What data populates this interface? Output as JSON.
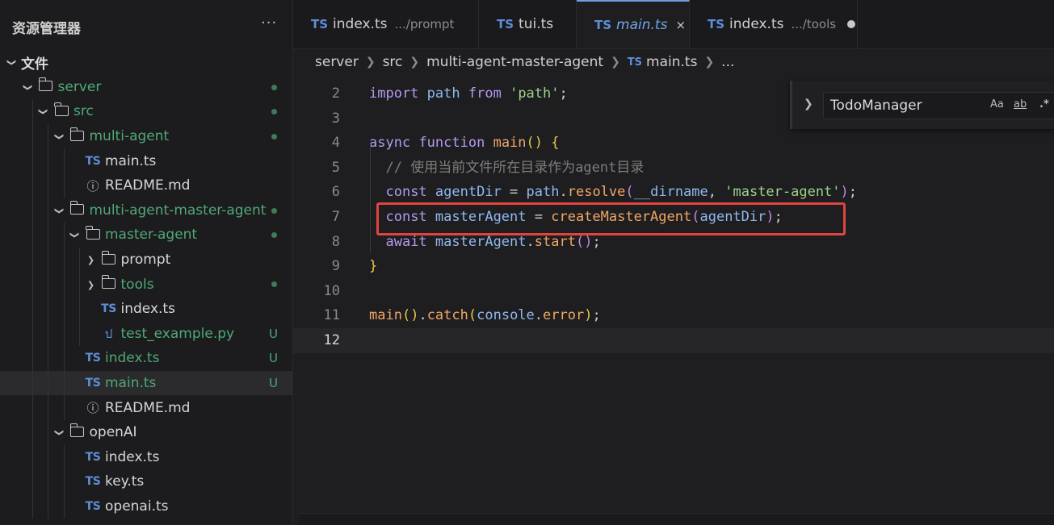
{
  "sidebar": {
    "title": "资源管理器",
    "more": "···",
    "tree": [
      {
        "label": "文件",
        "depth": 0,
        "type": "section",
        "expanded": true
      },
      {
        "label": "server",
        "depth": 1,
        "type": "folder",
        "expanded": true,
        "green": true,
        "dot": true
      },
      {
        "label": "src",
        "depth": 2,
        "type": "folder",
        "expanded": true,
        "green": true,
        "dot": true
      },
      {
        "label": "multi-agent",
        "depth": 3,
        "type": "folder",
        "expanded": true,
        "green": true,
        "dot": true
      },
      {
        "label": "main.ts",
        "depth": 4,
        "type": "ts"
      },
      {
        "label": "README.md",
        "depth": 4,
        "type": "info"
      },
      {
        "label": "multi-agent-master-agent",
        "depth": 3,
        "type": "folder",
        "expanded": true,
        "green": true,
        "dot": true
      },
      {
        "label": "master-agent",
        "depth": 4,
        "type": "folder",
        "expanded": true,
        "green": true,
        "dot": true
      },
      {
        "label": "prompt",
        "depth": 5,
        "type": "folder",
        "expanded": false
      },
      {
        "label": "tools",
        "depth": 5,
        "type": "folder",
        "expanded": false,
        "green": true,
        "dot": true
      },
      {
        "label": "index.ts",
        "depth": 5,
        "type": "ts"
      },
      {
        "label": "test_example.py",
        "depth": 5,
        "type": "py",
        "green": true,
        "badge": "U"
      },
      {
        "label": "index.ts",
        "depth": 4,
        "type": "ts",
        "green": true,
        "badge": "U"
      },
      {
        "label": "main.ts",
        "depth": 4,
        "type": "ts",
        "green": true,
        "badge": "U",
        "selected": true
      },
      {
        "label": "README.md",
        "depth": 4,
        "type": "info"
      },
      {
        "label": "openAI",
        "depth": 3,
        "type": "folder",
        "expanded": true
      },
      {
        "label": "index.ts",
        "depth": 4,
        "type": "ts"
      },
      {
        "label": "key.ts",
        "depth": 4,
        "type": "ts"
      },
      {
        "label": "openai.ts",
        "depth": 4,
        "type": "ts"
      }
    ]
  },
  "tabs": [
    {
      "icon": "TS",
      "name": "index.ts",
      "desc": ".../prompt"
    },
    {
      "icon": "TS",
      "name": "tui.ts"
    },
    {
      "icon": "TS",
      "name": "main.ts",
      "active": true,
      "close": "×"
    },
    {
      "icon": "TS",
      "name": "index.ts",
      "desc": ".../tools",
      "modified": true
    }
  ],
  "breadcrumb": {
    "parts": [
      "server",
      "src",
      "multi-agent-master-agent"
    ],
    "file_icon": "TS",
    "file": "main.ts",
    "ellipsis": "..."
  },
  "find_widget": {
    "value": "TodoManager",
    "opt_case": "Aa",
    "opt_word": "ab",
    "opt_regex": ".*"
  },
  "editor": {
    "current_line": 12,
    "lines": [
      {
        "n": "2",
        "tokens": [
          [
            "kw",
            "import"
          ],
          [
            "plain",
            " "
          ],
          [
            "var",
            "path"
          ],
          [
            "plain",
            " "
          ],
          [
            "kw",
            "from"
          ],
          [
            "plain",
            " "
          ],
          [
            "str",
            "'path'"
          ],
          [
            "plain",
            ";"
          ]
        ]
      },
      {
        "n": "3",
        "tokens": []
      },
      {
        "n": "4",
        "tokens": [
          [
            "kw",
            "async"
          ],
          [
            "plain",
            " "
          ],
          [
            "kw",
            "function"
          ],
          [
            "plain",
            " "
          ],
          [
            "fn",
            "main"
          ],
          [
            "br",
            "()"
          ],
          [
            "plain",
            " "
          ],
          [
            "br",
            "{"
          ]
        ]
      },
      {
        "n": "5",
        "tokens": [
          [
            "plain",
            "  "
          ],
          [
            "cmt",
            "// 使用当前文件所在目录作为agent目录"
          ]
        ]
      },
      {
        "n": "6",
        "tokens": [
          [
            "plain",
            "  "
          ],
          [
            "kw",
            "const"
          ],
          [
            "plain",
            " "
          ],
          [
            "var",
            "agentDir"
          ],
          [
            "plain",
            " = "
          ],
          [
            "var",
            "path"
          ],
          [
            "plain",
            "."
          ],
          [
            "fn",
            "resolve"
          ],
          [
            "brp",
            "("
          ],
          [
            "var",
            "__dirname"
          ],
          [
            "plain",
            ", "
          ],
          [
            "str",
            "'master-agent'"
          ],
          [
            "brp",
            ")"
          ],
          [
            "plain",
            ";"
          ]
        ]
      },
      {
        "n": "7",
        "tokens": [
          [
            "plain",
            "  "
          ],
          [
            "kw",
            "const"
          ],
          [
            "plain",
            " "
          ],
          [
            "var",
            "masterAgent"
          ],
          [
            "plain",
            " = "
          ],
          [
            "fn",
            "createMasterAgent"
          ],
          [
            "brp",
            "("
          ],
          [
            "var",
            "agentDir"
          ],
          [
            "brp",
            ")"
          ],
          [
            "plain",
            ";"
          ]
        ]
      },
      {
        "n": "8",
        "tokens": [
          [
            "plain",
            "  "
          ],
          [
            "kw",
            "await"
          ],
          [
            "plain",
            " "
          ],
          [
            "var",
            "masterAgent"
          ],
          [
            "plain",
            "."
          ],
          [
            "fn",
            "start"
          ],
          [
            "brp",
            "()"
          ],
          [
            "plain",
            ";"
          ]
        ]
      },
      {
        "n": "9",
        "tokens": [
          [
            "br",
            "}"
          ]
        ]
      },
      {
        "n": "10",
        "tokens": []
      },
      {
        "n": "11",
        "tokens": [
          [
            "fn",
            "main"
          ],
          [
            "br",
            "()"
          ],
          [
            "plain",
            "."
          ],
          [
            "fn",
            "catch"
          ],
          [
            "br",
            "("
          ],
          [
            "var",
            "console"
          ],
          [
            "plain",
            "."
          ],
          [
            "fn",
            "error"
          ],
          [
            "br",
            ")"
          ],
          [
            "plain",
            ";"
          ]
        ]
      },
      {
        "n": "12",
        "tokens": []
      }
    ]
  },
  "colors": {
    "accent": "#6d9ee0",
    "git_added": "#4fa877",
    "highlight_box": "#e0443f",
    "keyword": "#b49af0",
    "string": "#9dd189",
    "function": "#f0a765",
    "variable": "#8fb8ef"
  }
}
